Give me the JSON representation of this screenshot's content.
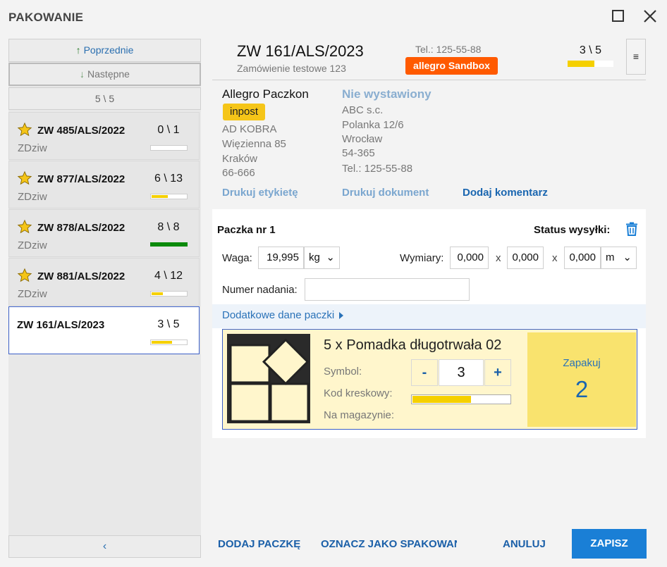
{
  "window": {
    "title": "PAKOWANIE"
  },
  "sidebar": {
    "prev_label": "Poprzednie",
    "next_label": "Następne",
    "counter": "5 \\ 5",
    "collapse_label": "‹",
    "orders": [
      {
        "id": "ZW 485/ALS/2022",
        "count": "0 \\ 1",
        "user": "ZDziw",
        "starred": true,
        "progress": 0
      },
      {
        "id": "ZW 877/ALS/2022",
        "count": "6 \\ 13",
        "user": "ZDziw",
        "starred": true,
        "progress": 0.46
      },
      {
        "id": "ZW 878/ALS/2022",
        "count": "8 \\ 8",
        "user": "ZDziw",
        "starred": true,
        "progress": 1
      },
      {
        "id": "ZW 881/ALS/2022",
        "count": "4 \\ 12",
        "user": "ZDziw",
        "starred": true,
        "progress": 0.33
      },
      {
        "id": "ZW 161/ALS/2023",
        "count": "3 \\ 5",
        "user": "",
        "starred": false,
        "progress": 0.6,
        "active": true
      }
    ]
  },
  "header": {
    "order_id": "ZW 161/ALS/2023",
    "subtitle": "Zamówienie testowe 123",
    "phone": "Tel.: 125-55-88",
    "source_badge": "allegro Sandbox",
    "count": "3 \\ 5",
    "progress": 0.6,
    "menu_label": "≡"
  },
  "shipping": {
    "carrier": "Allegro Paczkon",
    "carrier_badge": "inpost",
    "address": [
      "AD KOBRA",
      "Więzienna 85",
      "Kraków",
      "66-666"
    ],
    "print_label_link": "Drukuj etykietę"
  },
  "invoice": {
    "status": "Nie wystawiony",
    "address": [
      "ABC s.c.",
      "Polanka 12/6",
      "Wrocław",
      "54-365",
      "Tel.:  125-55-88"
    ],
    "print_doc_link": "Drukuj dokument",
    "add_comment_link": "Dodaj komentarz"
  },
  "package": {
    "title": "Paczka nr 1",
    "status_label": "Status wysyłki:",
    "weight_label": "Waga:",
    "weight_value": "19,995",
    "weight_unit": "kg",
    "dims_label": "Wymiary:",
    "dim1": "0,000",
    "dim2": "0,000",
    "dim3": "0,000",
    "dim_sep": "x",
    "dim_unit": "m",
    "tracking_label": "Numer nadania:",
    "tracking_value": "",
    "extra_link": "Dodatkowe dane paczki"
  },
  "item": {
    "name": "5 x Pomadka długotrwała 02",
    "symbol_label": "Symbol:",
    "barcode_label": "Kod kreskowy:",
    "stock_label": "Na magazynie:",
    "qty_minus": "-",
    "qty_value": "3",
    "qty_plus": "+",
    "progress": 0.6,
    "pack_label": "Zapakuj",
    "pack_count": "2"
  },
  "footer": {
    "add_package": "DODAJ PACZKĘ",
    "mark_packed": "OZNACZ JAKO SPAKOWANE",
    "cancel": "ANULUJ",
    "save": "ZAPISZ"
  },
  "colors": {
    "accent": "#1a7fd6",
    "progress_yellow": "#f5d000",
    "progress_green": "#0a8a0a",
    "sandbox": "#ff5a00",
    "carrier_badge": "#f5c518"
  }
}
